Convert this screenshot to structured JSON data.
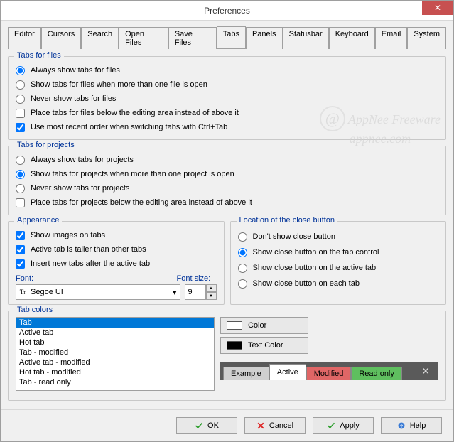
{
  "window": {
    "title": "Preferences"
  },
  "tabs": [
    "Editor",
    "Cursors",
    "Search",
    "Open Files",
    "Save Files",
    "Tabs",
    "Panels",
    "Statusbar",
    "Keyboard",
    "Email",
    "System"
  ],
  "active_tab": "Tabs",
  "tabs_for_files": {
    "legend": "Tabs for files",
    "opts": [
      "Always show tabs for files",
      "Show tabs for files when more than one file is open",
      "Never show tabs for files"
    ],
    "selected": 0,
    "check_below": "Place tabs for files below the editing area instead of above it",
    "check_below_val": false,
    "check_mru": "Use most recent order when switching tabs with Ctrl+Tab",
    "check_mru_val": true
  },
  "tabs_for_projects": {
    "legend": "Tabs for projects",
    "opts": [
      "Always show tabs for projects",
      "Show tabs for projects when more than one project is open",
      "Never show tabs for projects"
    ],
    "selected": 1,
    "check_below": "Place tabs for projects below the editing area instead of above it",
    "check_below_val": false
  },
  "appearance": {
    "legend": "Appearance",
    "chk_images": "Show images on tabs",
    "chk_images_val": true,
    "chk_taller": "Active tab is taller than other tabs",
    "chk_taller_val": true,
    "chk_insert": "Insert new tabs after the active tab",
    "chk_insert_val": true,
    "font_label": "Font:",
    "font_value": "Segoe UI",
    "size_label": "Font size:",
    "size_value": "9"
  },
  "closebtn": {
    "legend": "Location of the close button",
    "opts": [
      "Don't show close button",
      "Show close button on the tab control",
      "Show close button on the active tab",
      "Show close button on each tab"
    ],
    "selected": 1
  },
  "tabcolors": {
    "legend": "Tab colors",
    "items": [
      "Tab",
      "Active tab",
      "Hot tab",
      "Tab - modified",
      "Active tab - modified",
      "Hot tab - modified",
      "Tab - read only"
    ],
    "selected": 0,
    "color_btn": "Color",
    "textcolor_btn": "Text Color",
    "swatch_color": "#ffffff",
    "swatch_text": "#000000",
    "example": [
      "Example",
      "Active",
      "Modified",
      "Read only"
    ]
  },
  "buttons": {
    "ok": "OK",
    "cancel": "Cancel",
    "apply": "Apply",
    "help": "Help"
  },
  "watermark": {
    "line1": "AppNee Freeware",
    "line2": "appnee.com"
  }
}
